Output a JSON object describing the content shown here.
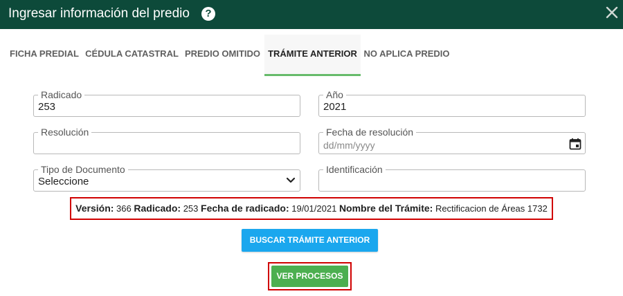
{
  "header": {
    "title": "Ingresar información del predio",
    "help_glyph": "?",
    "help_icon": "question-circle-icon",
    "close_icon": "close-icon",
    "background": "#0d4a3a"
  },
  "tabs": [
    {
      "label": "FICHA PREDIAL"
    },
    {
      "label": "CÉDULA CATASTRAL"
    },
    {
      "label": "PREDIO OMITIDO"
    },
    {
      "label": "TRÁMITE ANTERIOR"
    },
    {
      "label": "NO APLICA PREDIO"
    }
  ],
  "active_tab": "TRÁMITE ANTERIOR",
  "form": {
    "radicado": {
      "label": "Radicado",
      "value": "253"
    },
    "anio": {
      "label": "Año",
      "value": "2021"
    },
    "resolucion": {
      "label": "Resolución",
      "value": ""
    },
    "fecha_resolucion": {
      "label": "Fecha de resolución",
      "placeholder": "dd/mm/yyyy"
    },
    "tipo_documento": {
      "label": "Tipo de Documento",
      "value": "Seleccione"
    },
    "identificacion": {
      "label": "Identificación",
      "value": ""
    }
  },
  "info": {
    "version_label": "Versión:",
    "version_value": "366",
    "radicado_label": "Radicado:",
    "radicado_value": "253",
    "fecha_label": "Fecha de radicado:",
    "fecha_value": "19/01/2021",
    "nombre_label": "Nombre del Trámite:",
    "nombre_value": "Rectificacion de Áreas 1732"
  },
  "buttons": {
    "buscar": "BUSCAR TRÁMITE ANTERIOR",
    "ver_procesos": "VER PROCESOS"
  },
  "colors": {
    "header": "#0d4a3a",
    "active_tab_underline": "#66bb6a",
    "search_button": "#1aa7ee",
    "procesos_button": "#4caf50",
    "highlight": "#d00000"
  }
}
